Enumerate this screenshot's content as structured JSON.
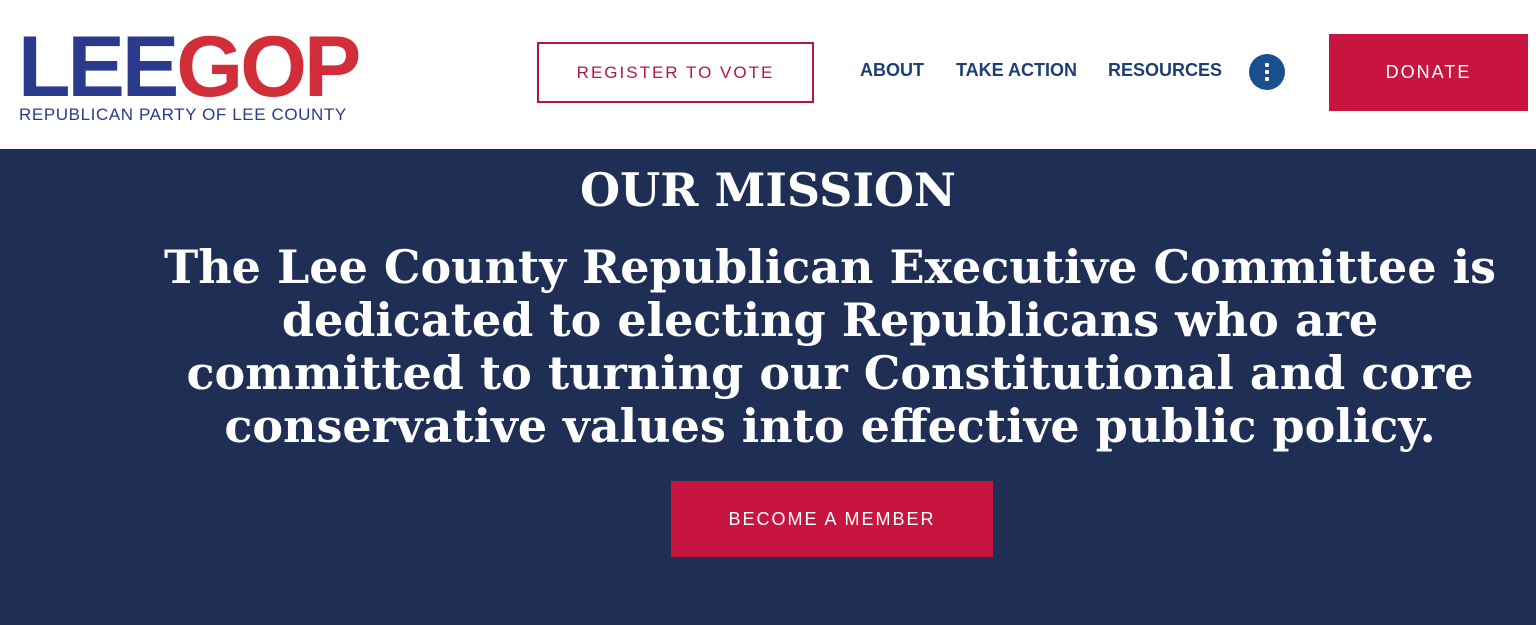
{
  "header": {
    "logo": {
      "word_part1": "LEE",
      "word_part2": "GOP",
      "subtitle": "REPUBLICAN PARTY OF LEE COUNTY"
    },
    "register_label": "REGISTER TO VOTE",
    "nav": [
      {
        "label": "ABOUT"
      },
      {
        "label": "TAKE ACTION"
      },
      {
        "label": "RESOURCES"
      }
    ],
    "more_icon": "vertical-dots-icon",
    "donate_label": "DONATE"
  },
  "mission": {
    "title": "OUR MISSION",
    "text": "The Lee County Republican Executive Committee is dedicated to electing Republicans who are committed to turning our Constitutional and core conservative values into effective public policy.",
    "button_label": "BECOME A MEMBER"
  },
  "colors": {
    "navy_background": "#1e2e55",
    "brand_blue": "#2b3a8c",
    "brand_red": "#d22e3a",
    "button_red": "#c8153f",
    "nav_text": "#1d3f73"
  }
}
